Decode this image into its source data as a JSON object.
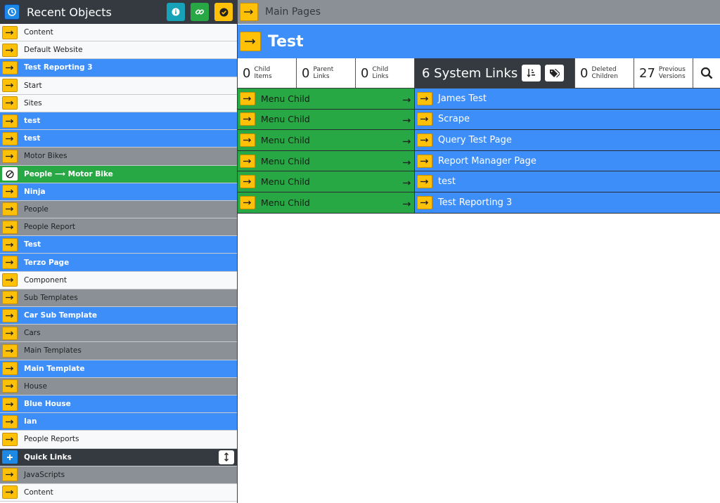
{
  "sidebar": {
    "title": "Recent Objects",
    "items": [
      {
        "label": "Content",
        "tone": "white"
      },
      {
        "label": "Default Website",
        "tone": "white"
      },
      {
        "label": "Test Reporting 3",
        "tone": "blue"
      },
      {
        "label": "Start",
        "tone": "white"
      },
      {
        "label": "Sites",
        "tone": "white"
      },
      {
        "label": "test",
        "tone": "blue"
      },
      {
        "label": "test",
        "tone": "blue"
      },
      {
        "label": "Motor Bikes",
        "tone": "grey"
      },
      {
        "label": "People ⟶ Motor Bike",
        "tone": "green"
      },
      {
        "label": "Ninja",
        "tone": "blue"
      },
      {
        "label": "People",
        "tone": "grey"
      },
      {
        "label": "People Report",
        "tone": "grey"
      },
      {
        "label": "Test",
        "tone": "blue"
      },
      {
        "label": "Terzo Page",
        "tone": "blue"
      },
      {
        "label": "Component",
        "tone": "white"
      },
      {
        "label": "Sub Templates",
        "tone": "grey"
      },
      {
        "label": "Car Sub Template",
        "tone": "blue"
      },
      {
        "label": "Cars",
        "tone": "grey"
      },
      {
        "label": "Main Templates",
        "tone": "grey"
      },
      {
        "label": "Main Template",
        "tone": "blue"
      },
      {
        "label": "House",
        "tone": "grey"
      },
      {
        "label": "Blue House",
        "tone": "blue"
      },
      {
        "label": "Ian",
        "tone": "blue"
      },
      {
        "label": "People Reports",
        "tone": "white"
      },
      {
        "label": "Quick Links",
        "tone": "dark"
      },
      {
        "label": "JavaScripts",
        "tone": "grey"
      },
      {
        "label": "Content",
        "tone": "white"
      }
    ]
  },
  "breadcrumb": {
    "label": "Main Pages"
  },
  "page": {
    "title": "Test"
  },
  "stats": {
    "child_items": {
      "count": "0",
      "label": "Child Items"
    },
    "parent_links": {
      "count": "0",
      "label": "Parent Links"
    },
    "child_links": {
      "count": "0",
      "label": "Child Links"
    },
    "system_links": {
      "text": "6 System Links"
    },
    "deleted_children": {
      "count": "0",
      "label": "Deleted Children"
    },
    "previous_versions": {
      "count": "27",
      "label": "Previous Versions"
    }
  },
  "links": {
    "left": [
      "Menu Child",
      "Menu Child",
      "Menu Child",
      "Menu Child",
      "Menu Child",
      "Menu Child"
    ],
    "right": [
      "James Test",
      "Scrape",
      "Query Test Page",
      "Report Manager Page",
      "test",
      "Test Reporting 3"
    ]
  },
  "colors": {
    "accent_blue": "#3d8ef8",
    "accent_yellow": "#ffc107",
    "accent_green": "#28a745",
    "dark": "#343a40",
    "grey": "#8a9096"
  }
}
